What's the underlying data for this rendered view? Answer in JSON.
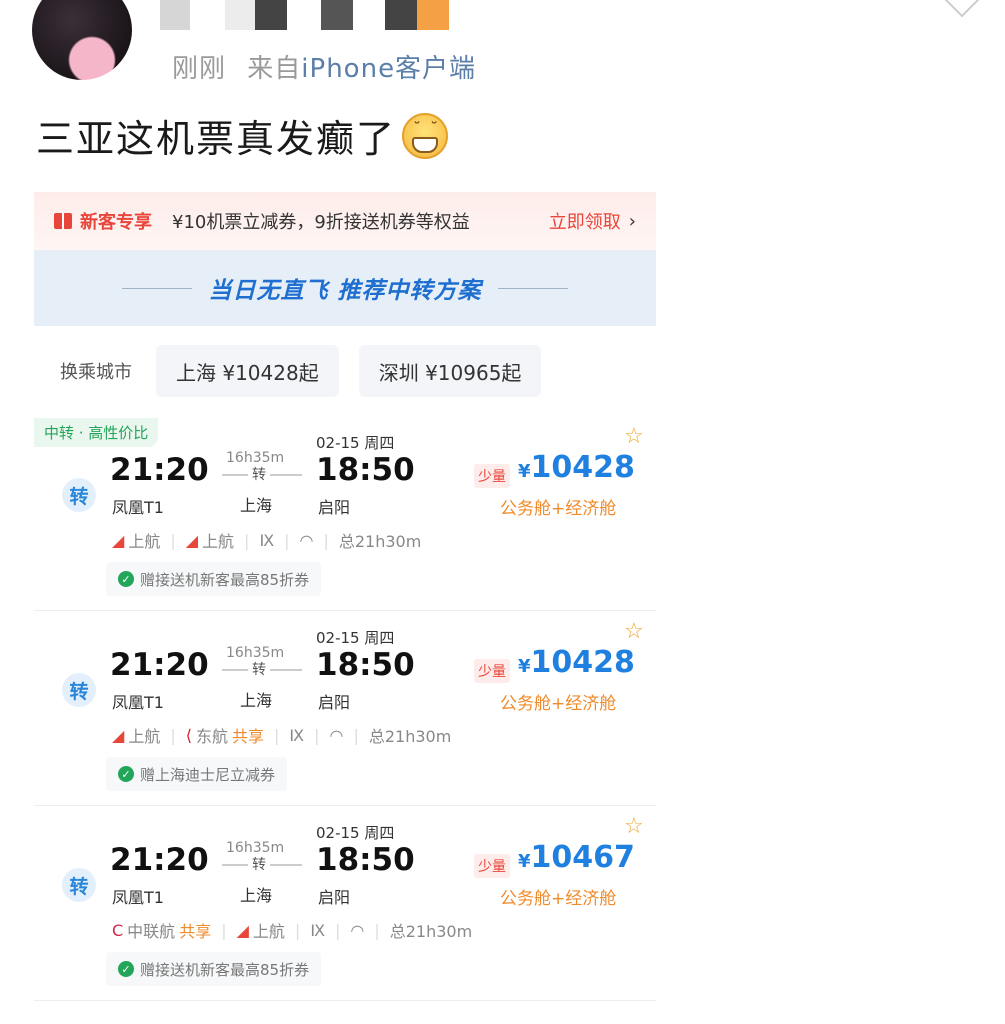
{
  "post": {
    "meta_time": "刚刚",
    "meta_from": "来自",
    "meta_source": "iPhone客户端",
    "text": "三亚这机票真发癫了"
  },
  "app": {
    "promo": {
      "tag": "新客专享",
      "desc": "¥10机票立减券，9折接送机券等权益",
      "claim": "立即领取",
      "arrow": "›"
    },
    "banner": "当日无直飞 推荐中转方案",
    "transfer": {
      "label": "换乘城市",
      "options": [
        "上海 ¥10428起",
        "深圳 ¥10965起"
      ]
    },
    "flights": [
      {
        "tagline": "中转 · 高性价比",
        "zhuan": "转",
        "dep_time": "21:20",
        "dep_airport": "凤凰T1",
        "duration": "16h35m",
        "mid": "转",
        "via": "上海",
        "date": "02-15 周四",
        "arr_time": "18:50",
        "arr_airport": "启阳",
        "stock": "少量",
        "currency": "¥",
        "price": "10428",
        "cabin": "公务舱+经济舱",
        "airline1": "上航",
        "airline2": "上航",
        "share2": "",
        "total": "总21h30m",
        "perk": "赠接送机新客最高85折券"
      },
      {
        "tagline": "",
        "zhuan": "转",
        "dep_time": "21:20",
        "dep_airport": "凤凰T1",
        "duration": "16h35m",
        "mid": "转",
        "via": "上海",
        "date": "02-15 周四",
        "arr_time": "18:50",
        "arr_airport": "启阳",
        "stock": "少量",
        "currency": "¥",
        "price": "10428",
        "cabin": "公务舱+经济舱",
        "airline1": "上航",
        "airline2": "东航",
        "share2": "共享",
        "total": "总21h30m",
        "perk": "赠上海迪士尼立减券"
      },
      {
        "tagline": "",
        "zhuan": "转",
        "dep_time": "21:20",
        "dep_airport": "凤凰T1",
        "duration": "16h35m",
        "mid": "转",
        "via": "上海",
        "date": "02-15 周四",
        "arr_time": "18:50",
        "arr_airport": "启阳",
        "stock": "少量",
        "currency": "¥",
        "price": "10467",
        "cabin": "公务舱+经济舱",
        "airline1": "中联航",
        "share1": "共享",
        "airline2": "上航",
        "total": "总21h30m",
        "perk": "赠接送机新客最高85折券"
      }
    ]
  },
  "icons": {
    "star": "star-outline-icon",
    "meal": "no-meal-icon",
    "wifi": "wifi-icon",
    "check": "check-circle-icon",
    "gift": "gift-icon"
  },
  "colors": {
    "price_blue": "#1f80e0",
    "promo_red": "#e9463b",
    "cabin_orange": "#f08a2a",
    "green_tag": "#23a55a",
    "banner_bg": "#e6eef8"
  }
}
